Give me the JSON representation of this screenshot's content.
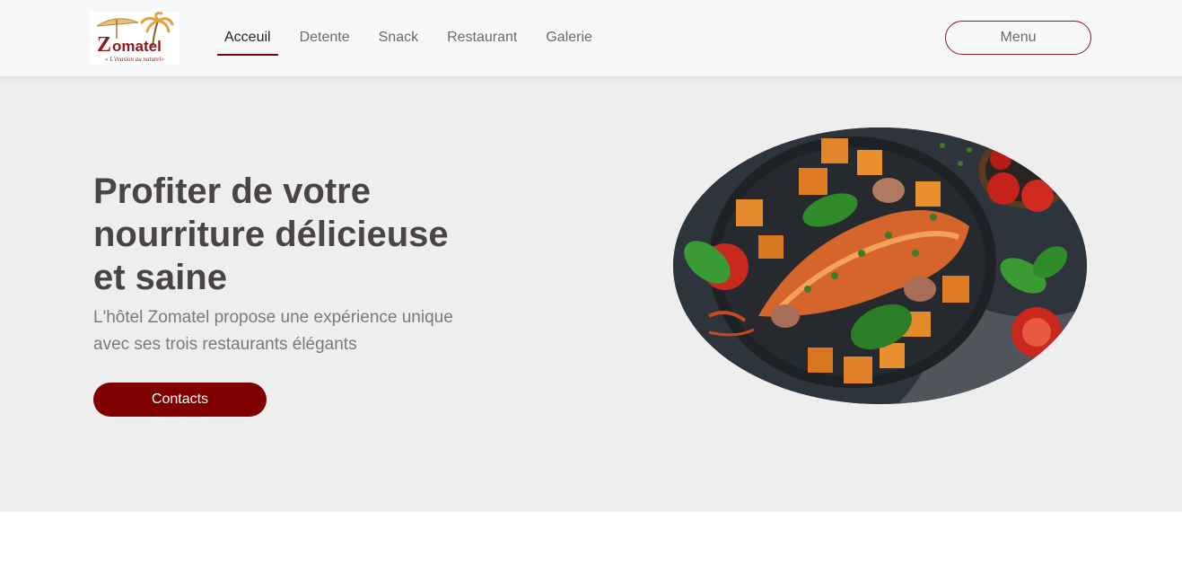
{
  "brand": {
    "name": "Zomatel",
    "tagline": "« L'évasion au naturel»",
    "colors": {
      "accent": "#800000",
      "hero_bg": "#eeeeee",
      "nav_bg": "#f7f8fa"
    }
  },
  "nav": {
    "links": [
      {
        "label": "Acceuil",
        "active": true
      },
      {
        "label": "Detente",
        "active": false
      },
      {
        "label": "Snack",
        "active": false
      },
      {
        "label": "Restaurant",
        "active": false
      },
      {
        "label": "Galerie",
        "active": false
      }
    ],
    "menu_label": "Menu"
  },
  "hero": {
    "title": "Profiter de votre\nnourriture délicieuse\net saine",
    "subtitle": "L'hôtel Zomatel propose une expérience unique avec ses trois restaurants élégants",
    "cta_label": "Contacts",
    "image_subject": "lobster-dish-photo"
  }
}
